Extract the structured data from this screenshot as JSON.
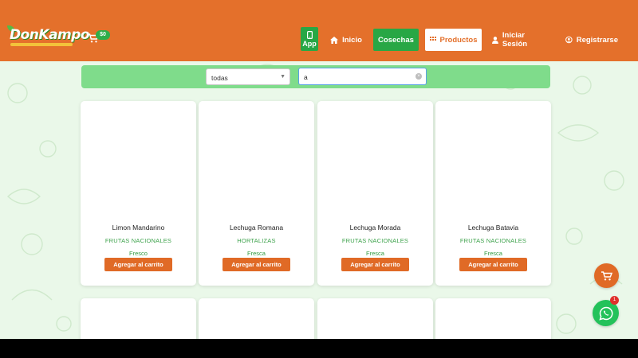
{
  "header": {
    "logo_text": "DonKampo",
    "cart_badge": "$0",
    "nav": {
      "app": "App",
      "inicio": "Inicio",
      "cosechas": "Cosechas",
      "productos": "Productos",
      "iniciar_sesion": "Iniciar Sesión",
      "registrarse": "Registrarse"
    },
    "colors": {
      "brand": "#e4702b",
      "green": "#28a745"
    }
  },
  "filters": {
    "category_selected": "todas",
    "search_value": "a"
  },
  "products": [
    {
      "name": "Limon Mandarino",
      "category": "FRUTAS NACIONALES",
      "state": "Fresco",
      "button": "Agregar al carrito"
    },
    {
      "name": "Lechuga Romana",
      "category": "HORTALIZAS",
      "state": "Fresca",
      "button": "Agregar al carrito"
    },
    {
      "name": "Lechuga Morada",
      "category": "FRUTAS NACIONALES",
      "state": "Fresca",
      "button": "Agregar al carrito"
    },
    {
      "name": "Lechuga Batavia",
      "category": "FRUTAS NACIONALES",
      "state": "Fresca",
      "button": "Agregar al carrito"
    }
  ],
  "floating": {
    "cart_icon": "cart-icon",
    "whatsapp_icon": "whatsapp-icon",
    "whatsapp_badge": "1"
  }
}
